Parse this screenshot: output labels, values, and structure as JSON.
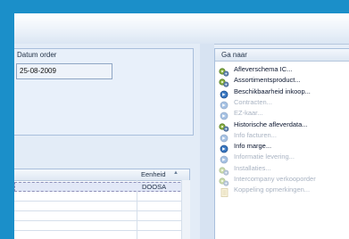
{
  "order": {
    "date_label": "Datum order",
    "date_value": "25-08-2009"
  },
  "grid": {
    "column_header": "Eenheid",
    "rows": [
      "DOOSA",
      "",
      "",
      "",
      "",
      ""
    ]
  },
  "goto": {
    "title": "Ga naar",
    "items": [
      {
        "label": "Afleverschema IC...",
        "enabled": true,
        "icon": "gears-icon"
      },
      {
        "label": "Assortimentsproduct...",
        "enabled": true,
        "icon": "gears-icon"
      },
      {
        "label": "Beschikbaarheid inkoop...",
        "enabled": true,
        "icon": "action-icon"
      },
      {
        "label": "Contracten...",
        "enabled": false,
        "icon": "action-icon"
      },
      {
        "label": "EZ-kaar...",
        "enabled": false,
        "icon": "action-icon"
      },
      {
        "label": "Historische afleverdata...",
        "enabled": true,
        "icon": "gears-icon"
      },
      {
        "label": "Info facturen...",
        "enabled": false,
        "icon": "action-icon"
      },
      {
        "label": "Info marge...",
        "enabled": true,
        "icon": "action-icon"
      },
      {
        "label": "Informatie levering...",
        "enabled": false,
        "icon": "action-icon"
      },
      {
        "label": "Installaties...",
        "enabled": false,
        "icon": "gears-icon"
      },
      {
        "label": "Intercompany verkooporder",
        "enabled": false,
        "icon": "gears-icon"
      },
      {
        "label": "Koppeling opmerkingen...",
        "enabled": false,
        "icon": "document-icon"
      }
    ]
  }
}
